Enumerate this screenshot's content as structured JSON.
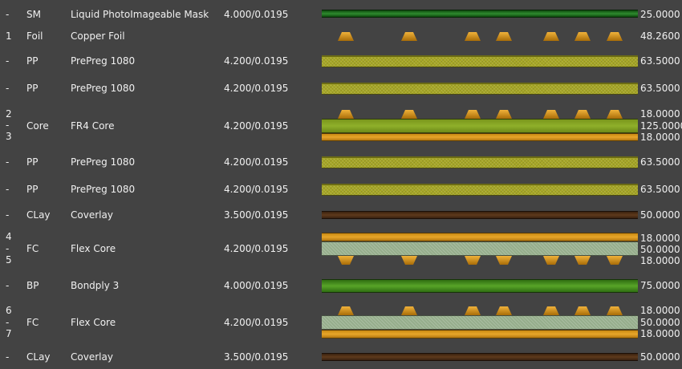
{
  "layers": [
    {
      "num": "-",
      "type": "SM",
      "name": "Liquid PhotoImageable Mask",
      "dielectric": "4.000/0.0195",
      "thickness": [
        "25.0000"
      ],
      "color": "#2f8a2f"
    },
    {
      "num": "1",
      "type": "Foil",
      "name": "Copper Foil",
      "dielectric": "",
      "thickness": [
        "48.2600"
      ],
      "color": "#e8a62a"
    },
    {
      "num": "-",
      "type": "PP",
      "name": "PrePreg 1080",
      "dielectric": "4.200/0.0195",
      "thickness": [
        "63.5000"
      ],
      "color": "#a7a725"
    },
    {
      "num": "-",
      "type": "PP",
      "name": "PrePreg 1080",
      "dielectric": "4.200/0.0195",
      "thickness": [
        "63.5000"
      ],
      "color": "#a7a725"
    },
    {
      "num": [
        "2",
        "-",
        "3"
      ],
      "type": "Core",
      "name": "FR4 Core",
      "dielectric": "4.200/0.0195",
      "thickness": [
        "18.0000",
        "125.0000",
        "18.0000"
      ],
      "color": "#8fb02a"
    },
    {
      "num": "-",
      "type": "PP",
      "name": "PrePreg 1080",
      "dielectric": "4.200/0.0195",
      "thickness": [
        "63.5000"
      ],
      "color": "#a7a725"
    },
    {
      "num": "-",
      "type": "PP",
      "name": "PrePreg 1080",
      "dielectric": "4.200/0.0195",
      "thickness": [
        "63.5000"
      ],
      "color": "#a7a725"
    },
    {
      "num": "-",
      "type": "CLay",
      "name": "Coverlay",
      "dielectric": "3.500/0.0195",
      "thickness": [
        "50.0000"
      ],
      "color": "#5e3a1c"
    },
    {
      "num": [
        "4",
        "-",
        "5"
      ],
      "type": "FC",
      "name": "Flex Core",
      "dielectric": "4.200/0.0195",
      "thickness": [
        "18.0000",
        "50.0000",
        "18.0000"
      ],
      "color": "#96ae8c"
    },
    {
      "num": "-",
      "type": "BP",
      "name": "Bondply 3",
      "dielectric": "4.000/0.0195",
      "thickness": [
        "75.0000"
      ],
      "color": "#58a428"
    },
    {
      "num": [
        "6",
        "-",
        "7"
      ],
      "type": "FC",
      "name": "Flex Core",
      "dielectric": "4.200/0.0195",
      "thickness": [
        "18.0000",
        "50.0000",
        "18.0000"
      ],
      "color": "#96ae8c"
    },
    {
      "num": "-",
      "type": "CLay",
      "name": "Coverlay",
      "dielectric": "3.500/0.0195",
      "thickness": [
        "50.0000"
      ],
      "color": "#5e3a1c"
    }
  ]
}
